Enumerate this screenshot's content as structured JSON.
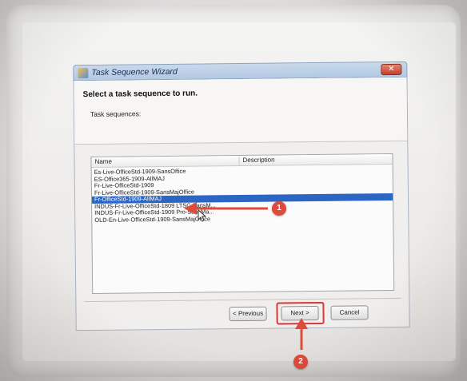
{
  "window": {
    "title": "Task Sequence Wizard",
    "close_glyph": "✕"
  },
  "content": {
    "heading": "Select a task sequence to run.",
    "list_label": "Task sequences:"
  },
  "list": {
    "columns": [
      "Name",
      "Description"
    ],
    "rows": [
      {
        "name": "Es-Live-OfficeStd-1909-SansOffice",
        "selected": false
      },
      {
        "name": "ES-Office365-1909-AllMAJ",
        "selected": false
      },
      {
        "name": "Fr-Live-OfficeStd-1909",
        "selected": false
      },
      {
        "name": "Fr-Live-OfficeStd-1909-SansMajOffice",
        "selected": false
      },
      {
        "name": "Fr-OfficeStd-1909-AllMAJ",
        "selected": true
      },
      {
        "name": "INDUS-Fr-Live-OfficeStd-1809 LTSC SansM...",
        "selected": false
      },
      {
        "name": "INDUS-Fr-Live-OfficeStd-1909 Pro-SansMa...",
        "selected": false
      },
      {
        "name": "OLD-En-Live-OfficeStd-1909-SansMajOffice",
        "selected": false
      }
    ]
  },
  "buttons": {
    "previous": "< Previous",
    "next": "Next >",
    "cancel": "Cancel"
  },
  "annotations": {
    "step1": "1",
    "step2": "2",
    "color": "#e04a3a"
  },
  "colors": {
    "selection": "#2c66c5",
    "titlebar": "#b3c9e3",
    "highlight": "#d9383a"
  }
}
